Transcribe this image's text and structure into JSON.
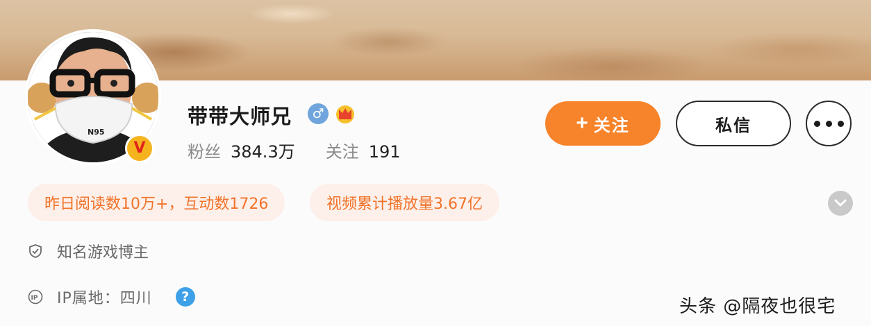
{
  "profile": {
    "name": "带带大师兄",
    "gender_symbol": "♂",
    "verified_symbol": "V",
    "avatar_mask_text": "N95"
  },
  "stats": {
    "fans_label": "粉丝",
    "fans_value": "384.3万",
    "following_label": "关注",
    "following_value": "191"
  },
  "actions": {
    "follow_plus": "+",
    "follow_label": "关注",
    "message_label": "私信"
  },
  "tags": [
    "昨日阅读数10万+，互动数1726",
    "视频累计播放量3.67亿"
  ],
  "info": {
    "title": "知名游戏博主",
    "ip_location": "IP属地：四川",
    "help_symbol": "?"
  },
  "watermark": "头条 @隔夜也很宅",
  "colors": {
    "accent": "#f7832a",
    "tag_text": "#f1732a",
    "tag_bg": "#fdf0ea",
    "verified_badge": "#f5b31e",
    "gender_badge": "#6fa4dc",
    "help_icon": "#3ea1e8"
  },
  "icons": {
    "gender": "male-icon",
    "crown": "crown-icon",
    "verified": "verified-badge-icon",
    "more": "more-dots-icon",
    "expand": "chevron-down-icon",
    "title": "shield-check-icon",
    "ip": "ip-icon",
    "help": "question-icon"
  }
}
